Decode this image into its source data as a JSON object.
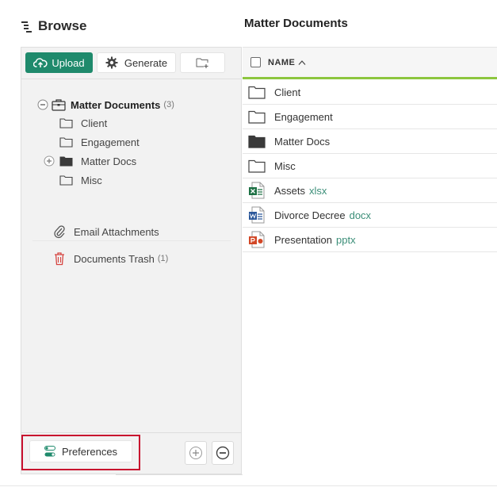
{
  "browse": {
    "title": "Browse"
  },
  "main": {
    "title": "Matter Documents"
  },
  "toolbar": {
    "upload_label": "Upload",
    "generate_label": "Generate",
    "upload_color": "#1f8a6c"
  },
  "tree": {
    "root": {
      "label": "Matter Documents",
      "count": "(3)"
    },
    "children": [
      "Client",
      "Engagement",
      "Matter Docs",
      "Misc"
    ],
    "email_label": "Email Attachments",
    "trash_label": "Documents Trash",
    "trash_count": "(1)"
  },
  "bottom": {
    "preferences_label": "Preferences"
  },
  "table": {
    "column_name": "NAME",
    "rows": [
      {
        "name": "Client",
        "ext": "",
        "icon": "folder-outline-icon"
      },
      {
        "name": "Engagement",
        "ext": "",
        "icon": "folder-outline-icon"
      },
      {
        "name": "Matter Docs",
        "ext": "",
        "icon": "folder-filled-icon"
      },
      {
        "name": "Misc",
        "ext": "",
        "icon": "folder-outline-icon"
      },
      {
        "name": "Assets",
        "ext": "xlsx",
        "icon": "excel-file-icon"
      },
      {
        "name": "Divorce Decree",
        "ext": "docx",
        "icon": "word-file-icon"
      },
      {
        "name": "Presentation",
        "ext": "pptx",
        "icon": "powerpoint-file-icon"
      }
    ]
  },
  "colors": {
    "accent_green": "#8dc63f",
    "highlight_red": "#c8102e",
    "ext_color": "#3b8e78"
  }
}
